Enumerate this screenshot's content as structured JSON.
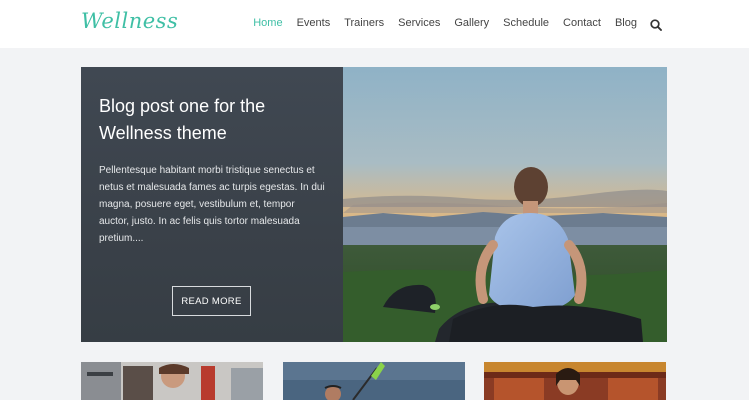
{
  "site": {
    "logo": "Wellness",
    "accent_color": "#3fbfa5"
  },
  "nav": {
    "items": [
      {
        "label": "Home",
        "active": true
      },
      {
        "label": "Events",
        "active": false
      },
      {
        "label": "Trainers",
        "active": false
      },
      {
        "label": "Services",
        "active": false
      },
      {
        "label": "Gallery",
        "active": false
      },
      {
        "label": "Schedule",
        "active": false
      },
      {
        "label": "Contact",
        "active": false
      },
      {
        "label": "Blog",
        "active": false
      }
    ],
    "search_icon": "search-icon"
  },
  "hero": {
    "title": "Blog post one for the Wellness theme",
    "excerpt": "Pellentesque habitant morbi tristique senectus et netus et malesuada fames ac turpis egestas. In dui magna, posuere eget, vestibulum et, tempor auctor, justo. In ac felis quis tortor malesuada pretium....",
    "read_more_label": "READ MORE"
  }
}
